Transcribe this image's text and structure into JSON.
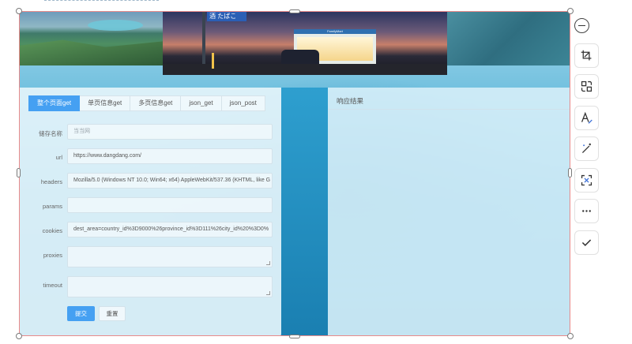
{
  "banner": {
    "sign_text": "酒 たばこ",
    "store_name": "FamilyMart"
  },
  "form": {
    "tabs": [
      {
        "label": "整个页面get",
        "active": true
      },
      {
        "label": "单页信息get",
        "active": false
      },
      {
        "label": "多页信息get",
        "active": false
      },
      {
        "label": "json_get",
        "active": false
      },
      {
        "label": "json_post",
        "active": false
      }
    ],
    "fields": {
      "name": {
        "label": "储存名称",
        "value": "当当网"
      },
      "url": {
        "label": "url",
        "value": "https://www.dangdang.com/"
      },
      "headers": {
        "label": "headers",
        "value": "Mozilla/5.0 (Windows NT 10.0; Win64; x64) AppleWebKit/537.36 (KHTML, like G"
      },
      "params": {
        "label": "params",
        "value": ""
      },
      "cookies": {
        "label": "cookies",
        "value": "dest_area=country_id%3D9000%26province_id%3D111%26city_id%20%3D0%"
      },
      "proxies": {
        "label": "proxies",
        "value": ""
      },
      "timeout": {
        "label": "timeout",
        "value": ""
      }
    },
    "submit_label": "提交",
    "reset_label": "重置"
  },
  "response": {
    "title": "响应结果"
  },
  "toolbar": {
    "tools": [
      "minus-icon",
      "crop-icon",
      "swap-icon",
      "text-edit-icon",
      "magic-wand-icon",
      "ocr-scan-icon",
      "more-icon",
      "confirm-check-icon"
    ]
  },
  "colors": {
    "accent": "#45a0f2",
    "selection_border": "#e88a8a"
  }
}
